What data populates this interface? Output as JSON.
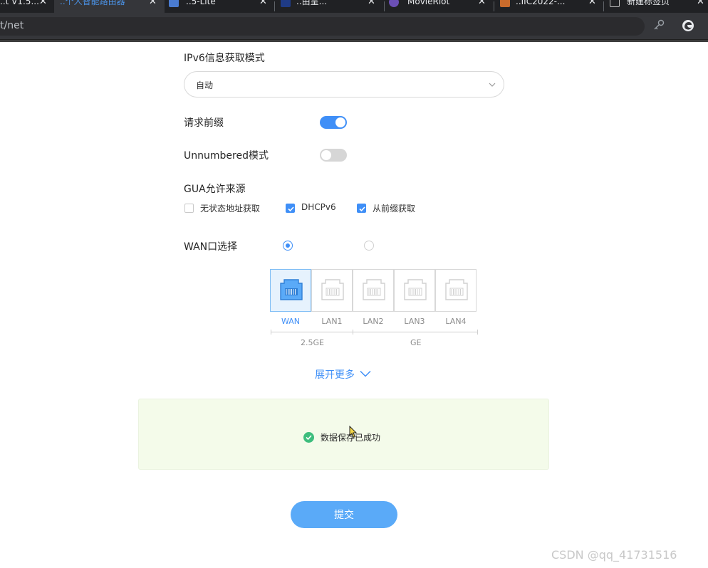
{
  "browser": {
    "tabs": [
      {
        "title": "..t V1.5..."
      },
      {
        "title": "..个人智能路由器"
      },
      {
        "title": "..5-Lite"
      },
      {
        "title": "..由呈..."
      },
      {
        "title": "MovieRiot"
      },
      {
        "title": "..IIC2022-..."
      },
      {
        "title": "新建标签页"
      }
    ],
    "url": "t/net",
    "colors": {
      "active_tab_text": "#4a90e2"
    }
  },
  "form": {
    "ipv6_mode_label": "IPv6信息获取模式",
    "ipv6_mode_value": "自动",
    "request_prefix_label": "请求前缀",
    "request_prefix_on": true,
    "unnumbered_label": "Unnumbered模式",
    "unnumbered_on": false,
    "gua_label": "GUA允许来源",
    "gua_options": [
      {
        "label": "无状态地址获取",
        "checked": false
      },
      {
        "label": "DHCPv6",
        "checked": true
      },
      {
        "label": "从前缀获取",
        "checked": true
      }
    ],
    "wan_select_label": "WAN口选择",
    "wan_radios": [
      {
        "selected": true
      },
      {
        "selected": false
      }
    ],
    "ports": [
      {
        "label": "WAN",
        "selected": true
      },
      {
        "label": "LAN1",
        "selected": false
      },
      {
        "label": "LAN2",
        "selected": false
      },
      {
        "label": "LAN3",
        "selected": false
      },
      {
        "label": "LAN4",
        "selected": false
      }
    ],
    "port_groups": [
      "2.5GE",
      "GE"
    ],
    "expand_more": "展开更多"
  },
  "message": {
    "text": "数据保存已成功",
    "icon": "check-circle-icon"
  },
  "submit_label": "提交",
  "watermark": "CSDN @qq_41731516",
  "colors": {
    "primary": "#3f8ff7",
    "success": "#3dbd7d",
    "message_bg": "#f4fbea",
    "submit_bg": "#5aaaf8"
  }
}
